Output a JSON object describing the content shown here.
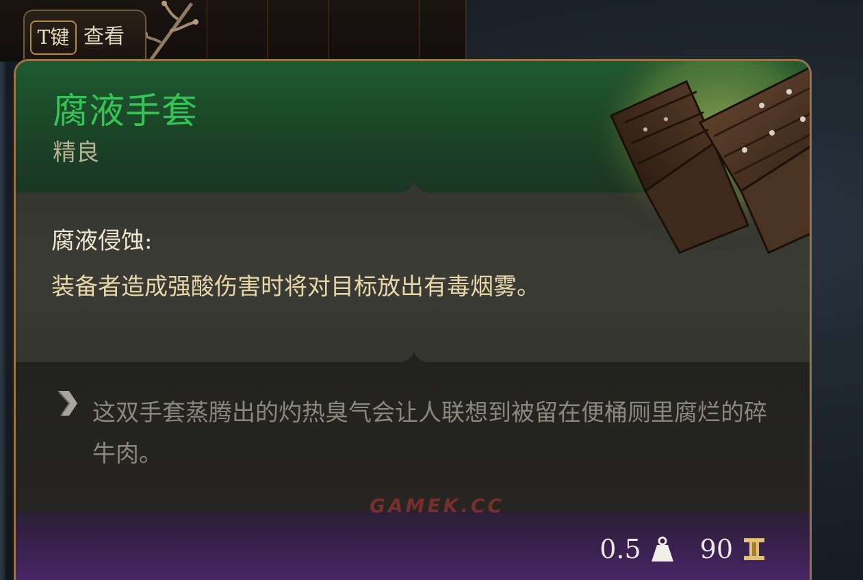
{
  "hint": {
    "key_label": "T键",
    "action_label": "查看",
    "icon": "t-key-icon"
  },
  "item": {
    "name": "腐液手套",
    "rarity": "精良",
    "name_color": "#35c455",
    "art_icon": "leather-gloves-icon"
  },
  "effect": {
    "title": "腐液侵蚀:",
    "description": "装备者造成强酸伤害时将对目标放出有毒烟雾。"
  },
  "lore": {
    "icon": "quill-icon",
    "text": "这双手套蒸腾出的灼热臭气会让人联想到被留在便桶厕里腐烂的碎牛肉。"
  },
  "stats": {
    "weight": "0.5",
    "weight_icon": "weight-icon",
    "value": "90",
    "value_icon": "gold-coin-icon"
  },
  "watermark": "GAMEK.CC"
}
